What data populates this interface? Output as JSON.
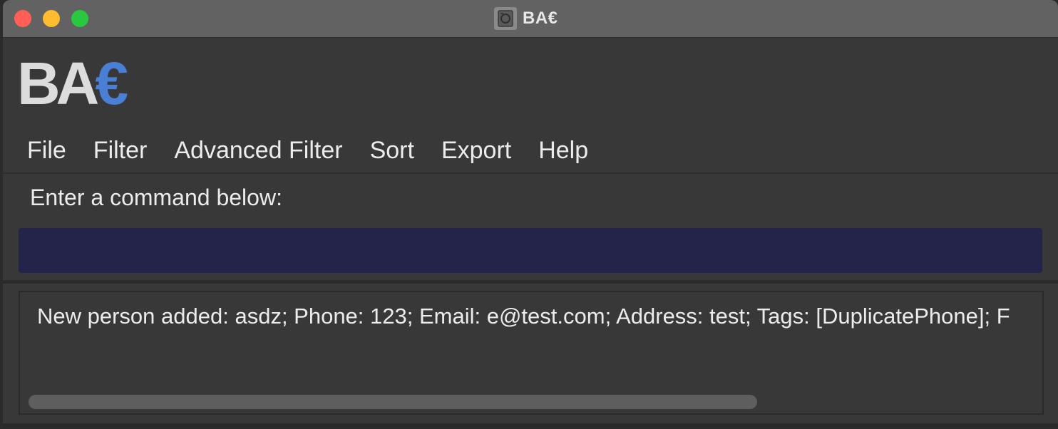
{
  "window": {
    "title": "BA€"
  },
  "logo": {
    "main": "BA",
    "accent": "€"
  },
  "menu": {
    "items": [
      {
        "label": "File"
      },
      {
        "label": "Filter"
      },
      {
        "label": "Advanced Filter"
      },
      {
        "label": "Sort"
      },
      {
        "label": "Export"
      },
      {
        "label": "Help"
      }
    ]
  },
  "command": {
    "label": "Enter a command below:",
    "value": "",
    "placeholder": ""
  },
  "result": {
    "text": "New person added: asdz; Phone: 123; Email: e@test.com; Address: test; Tags: [DuplicatePhone]; F"
  },
  "colors": {
    "logo_accent": "#4a7fd6",
    "command_box_bg": "#24244a"
  },
  "icons": {
    "app_icon": "app-icon"
  }
}
